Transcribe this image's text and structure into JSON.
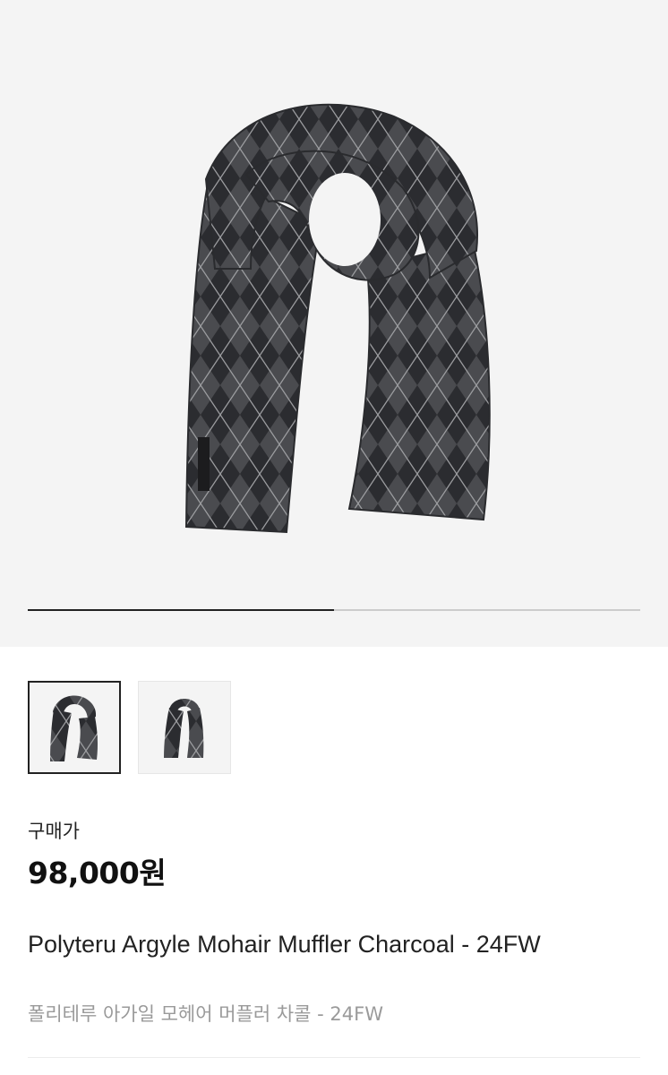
{
  "gallery": {
    "main_image": "argyle-scarf-photo",
    "current_slide_fraction": 0.5,
    "thumbnails": [
      {
        "image": "argyle-scarf-thumb-1",
        "selected": true
      },
      {
        "image": "argyle-scarf-thumb-2",
        "selected": false
      }
    ],
    "background_color": "#f4f4f4",
    "active_color": "#222222"
  },
  "product": {
    "price_label": "구매가",
    "price": "98,000원",
    "name_en": "Polyteru Argyle Mohair Muffler Charcoal - 24FW",
    "name_ko": "폴리테루 아가일 모헤어 머플러 차콜 - 24FW"
  }
}
